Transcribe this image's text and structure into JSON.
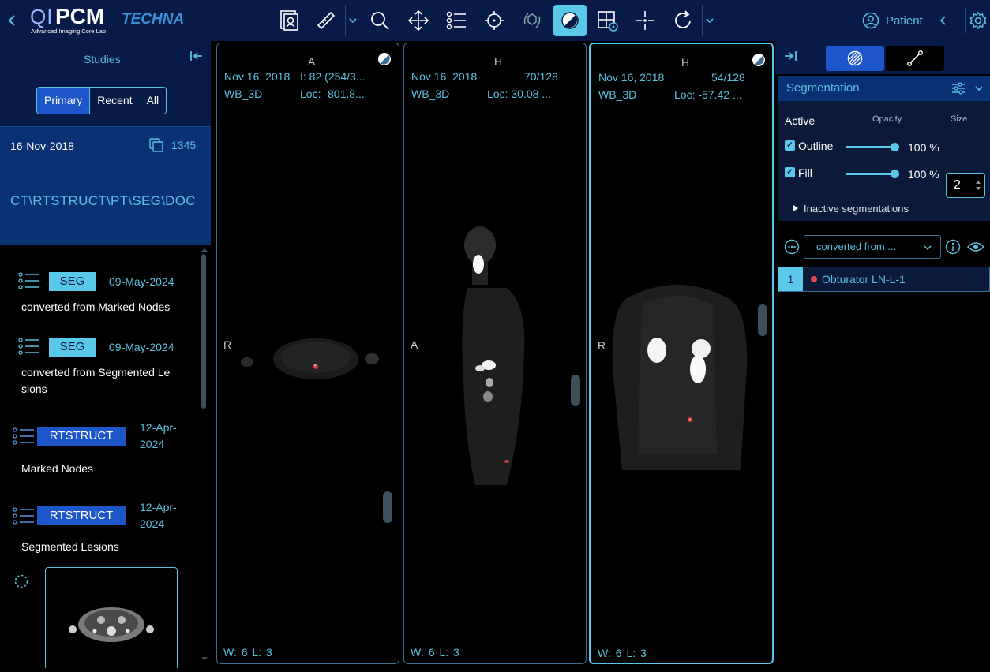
{
  "app": {
    "logo_prefix": "QI",
    "logo_name": "PCM",
    "logo_subtitle": "Advanced Imaging Core Lab",
    "partner_logo": "TECHNA"
  },
  "toolbar": {
    "tools": [
      "study-browser-icon",
      "measure-ruler-icon",
      "zoom-icon",
      "pan-icon",
      "list-icon",
      "crosshair-icon",
      "rotate-3d-icon",
      "window-level-icon",
      "layout-settings-icon",
      "reference-lines-icon",
      "reset-icon"
    ],
    "active_tool": "window-level-icon",
    "patient_label": "Patient"
  },
  "studies": {
    "title": "Studies",
    "tabs": [
      "Primary",
      "Recent",
      "All"
    ],
    "active_tab": "Primary",
    "study": {
      "date": "16-Nov-2018",
      "count": "1345",
      "modalities": "CT\\RTSTRUCT\\PT\\SEG\\DOC"
    },
    "series": [
      {
        "badge": "SEG",
        "date": "09-May-2024",
        "description": "converted from Marked Nodes"
      },
      {
        "badge": "SEG",
        "date": "09-May-2024",
        "description": "converted from Segmented Le sions"
      },
      {
        "badge": "RTSTRUCT",
        "date": "12-Apr-2024",
        "description": "Marked Nodes"
      },
      {
        "badge": "RTSTRUCT",
        "date": "12-Apr-2024",
        "description": "Segmented Lesions"
      }
    ]
  },
  "viewports": [
    {
      "orientation_top": "A",
      "date": "Nov 16, 2018",
      "series": "WB_3D",
      "info": "I: 82 (254/3...",
      "loc": "Loc: -801.8...",
      "orientation_left": "R",
      "w_label": "W:",
      "w_value": "6",
      "l_label": "L:",
      "l_value": "3"
    },
    {
      "orientation_top": "H",
      "date": "Nov 16, 2018",
      "series": "WB_3D",
      "info": "70/128",
      "loc": "Loc: 30.08 ...",
      "orientation_left": "A",
      "w_label": "W:",
      "w_value": "6",
      "l_label": "L:",
      "l_value": "3"
    },
    {
      "orientation_top": "H",
      "date": "Nov 16, 2018",
      "series": "WB_3D",
      "info": "54/128",
      "loc": "Loc: -57.42 ...",
      "orientation_left": "R",
      "w_label": "W:",
      "w_value": "6",
      "l_label": "L:",
      "l_value": "3"
    }
  ],
  "segmentation_panel": {
    "title": "Segmentation",
    "active_label": "Active",
    "opacity_label": "Opacity",
    "size_label": "Size",
    "outline_label": "Outline",
    "outline_opacity": "100 %",
    "fill_label": "Fill",
    "fill_opacity": "100 %",
    "size_value": "2",
    "inactive_label": "Inactive segmentations",
    "selected_segmentation": "converted from ...",
    "segments": [
      {
        "index": "1",
        "label": "Obturator LN-L-1",
        "color": "#e04a50"
      }
    ]
  },
  "colors": {
    "accent": "#5ac8e8",
    "navy": "#081b48",
    "primary_blue": "#1d56c8"
  }
}
